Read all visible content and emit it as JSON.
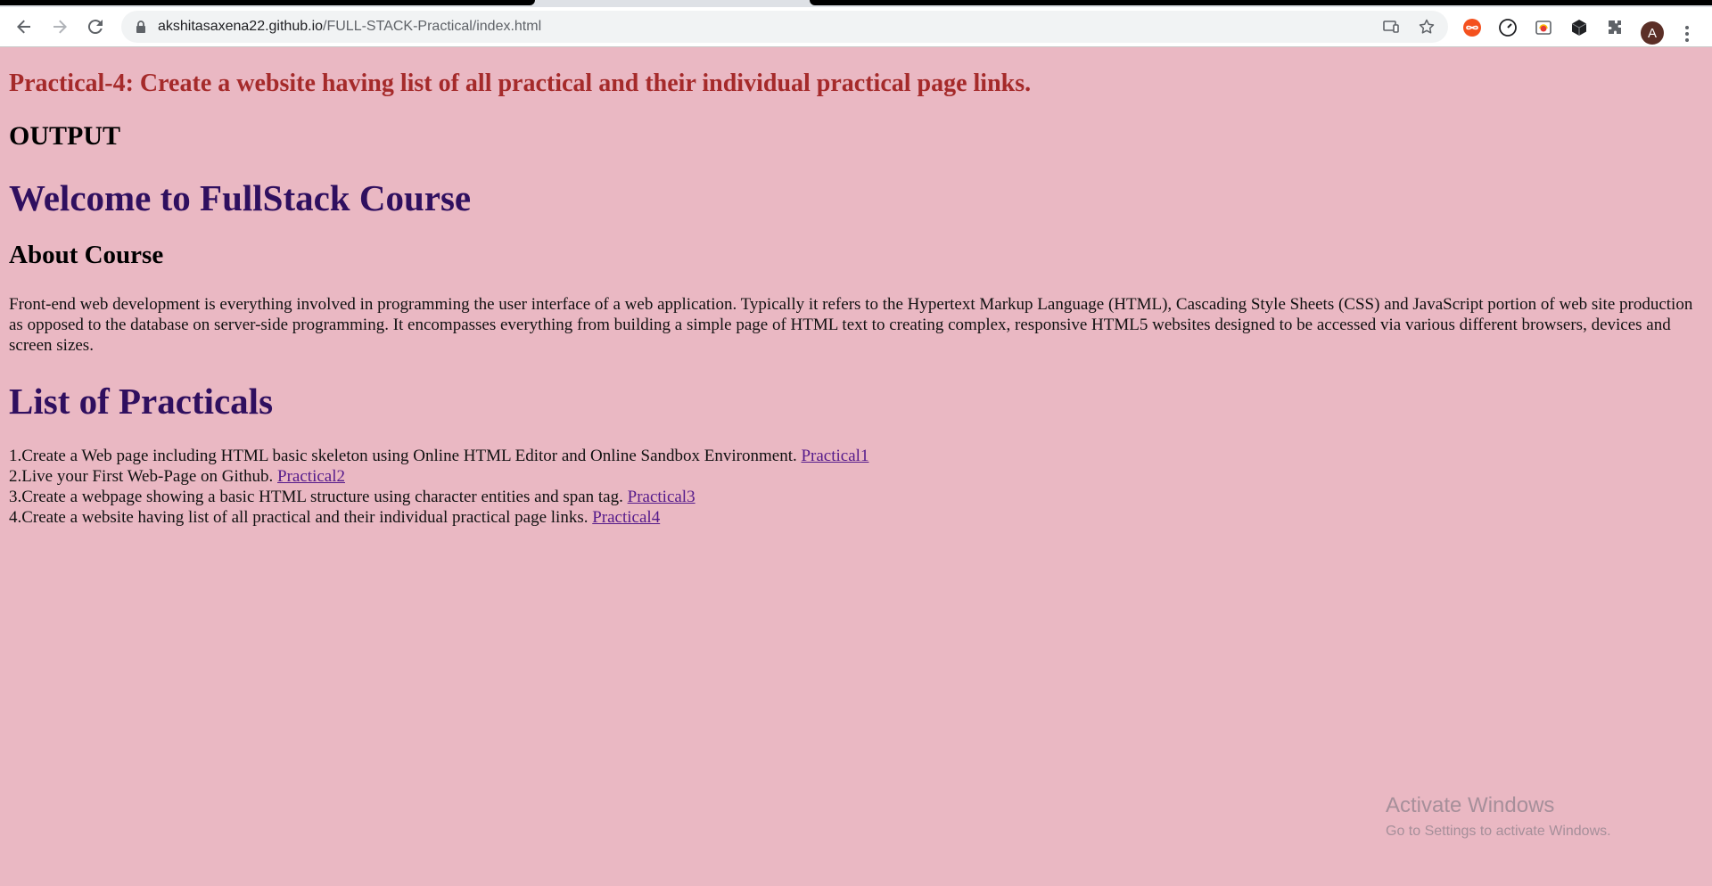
{
  "browser": {
    "url_host": "akshitasaxena22.github.io",
    "url_path": "/FULL-STACK-Practical/index.html",
    "profile_initial": "A",
    "icons": [
      "back-icon",
      "forward-icon",
      "reload-icon",
      "lock-icon",
      "cast-icon",
      "star-icon",
      "extension-infinity-icon",
      "extension-speedometer-icon",
      "extension-screenshot-icon",
      "extension-cube-icon",
      "puzzle-icon",
      "kebab-menu-icon"
    ]
  },
  "page": {
    "title": "Practical-4: Create a website having list of all practical and their individual practical page links.",
    "output_label": "OUTPUT",
    "welcome_heading": "Welcome to FullStack Course",
    "about_heading": "About Course",
    "about_text": "Front-end web development is everything involved in programming the user interface of a web application. Typically it refers to the Hypertext Markup Language (HTML), Cascading Style Sheets (CSS) and JavaScript portion of web site production as opposed to the database on server-side programming. It encompasses everything from building a simple page of HTML text to creating complex, responsive HTML5 websites designed to be accessed via various different browsers, devices and screen sizes.",
    "practicals_heading": "List of Practicals",
    "practicals": [
      {
        "text": "1.Create a Web page including HTML basic skeleton using Online HTML Editor and Online Sandbox Environment.",
        "link": "Practical1"
      },
      {
        "text": "2.Live your First Web-Page on Github.",
        "link": "Practical2"
      },
      {
        "text": "3.Create a webpage showing a basic HTML structure using character entities and span tag.",
        "link": "Practical3"
      },
      {
        "text": "4.Create a website having list of all practical and their individual practical page links.",
        "link": "Practical4"
      }
    ]
  },
  "watermark": {
    "title": "Activate Windows",
    "subtitle": "Go to Settings to activate Windows."
  },
  "colors": {
    "page_background": "#eab8c3",
    "title_red": "#a52a2a",
    "heading_purple": "#2f0f5f",
    "link_purple": "#551a8b"
  }
}
